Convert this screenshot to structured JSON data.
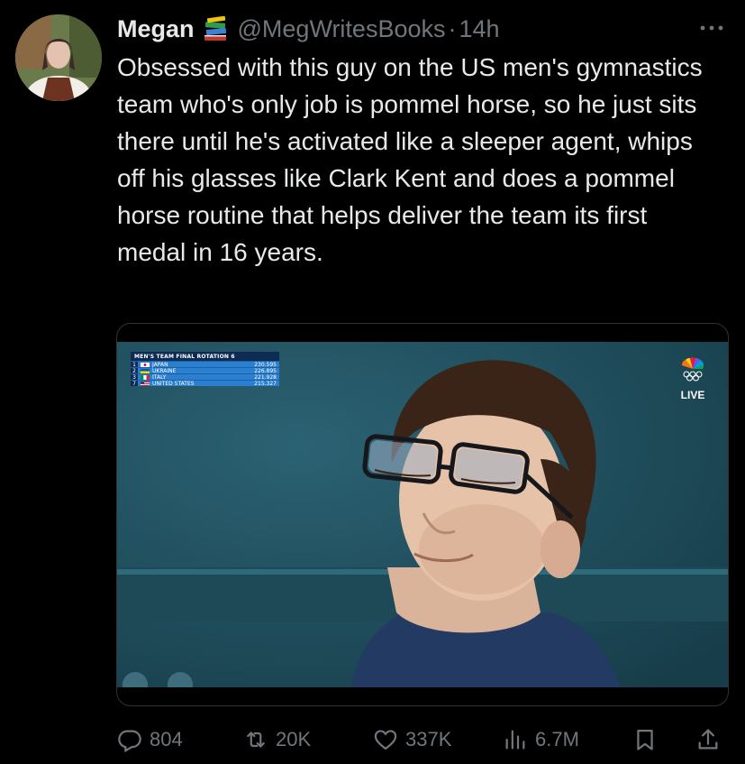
{
  "author": {
    "name": "Megan",
    "handle": "@MegWritesBooks",
    "separator": "·",
    "time": "14h",
    "badge_icon": "books-icon"
  },
  "tweet": {
    "text": "Obsessed with this guy on the US men's gymnastics team who's only job is pommel horse, so he just sits there until he's activated like a sleeper agent, whips off his glasses like Clark Kent and does a pommel horse routine that helps deliver the team its first medal in 16 years."
  },
  "media": {
    "scoreboard": {
      "title": "MEN'S TEAM FINAL  ROTATION 6",
      "rows": [
        {
          "rank": "1",
          "country": "JAPAN",
          "score": "230.595"
        },
        {
          "rank": "2",
          "country": "UKRAINE",
          "score": "226.895"
        },
        {
          "rank": "3",
          "country": "ITALY",
          "score": "221.928"
        },
        {
          "rank": "7",
          "country": "UNITED STATES",
          "score": "215.327"
        }
      ]
    },
    "live_label": "LIVE"
  },
  "actions": {
    "replies": "804",
    "retweets": "20K",
    "likes": "337K",
    "views": "6.7M"
  },
  "colors": {
    "background": "#000000",
    "text": "#e7e9ea",
    "muted": "#71767b",
    "border": "#2f3336"
  }
}
